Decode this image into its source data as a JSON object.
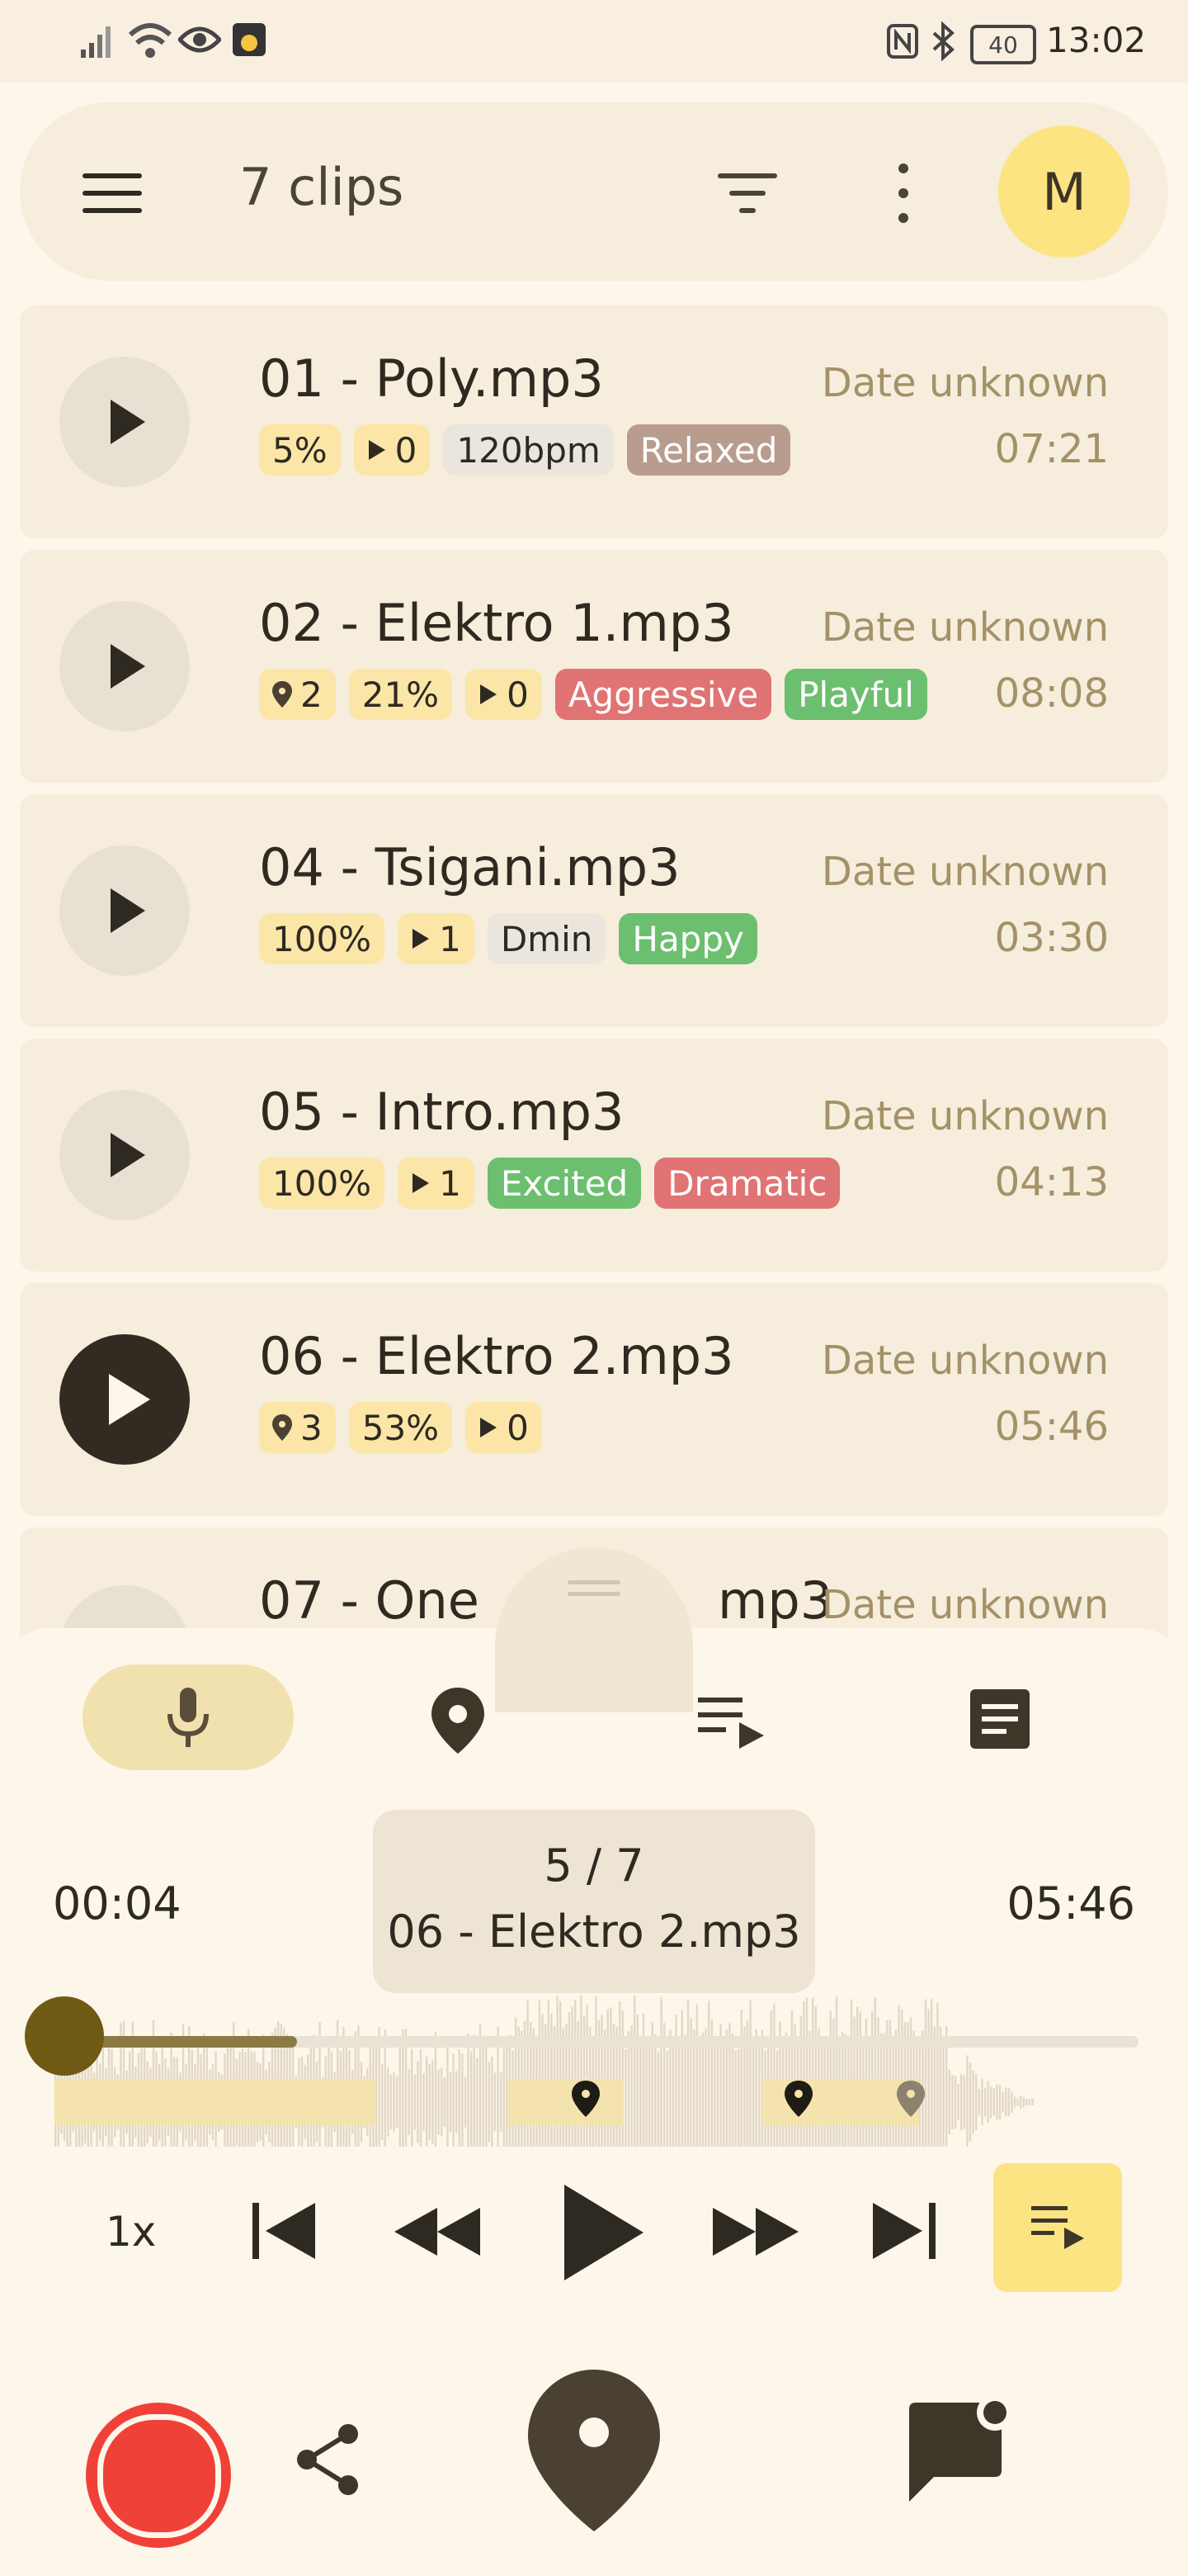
{
  "status_bar": {
    "battery": "40",
    "time": "13:02"
  },
  "app_bar": {
    "title": "7 clips",
    "avatar_letter": "M"
  },
  "clips": [
    {
      "title": "01 - Poly.mp3",
      "date": "Date unknown",
      "duration": "07:21",
      "chips": [
        {
          "text": "5%",
          "style": "y"
        },
        {
          "text": "0",
          "style": "y",
          "icon": "play"
        },
        {
          "text": "120bpm",
          "style": "g"
        },
        {
          "text": "Relaxed",
          "style": "brown"
        }
      ]
    },
    {
      "title": "02 - Elektro 1.mp3",
      "date": "Date unknown",
      "duration": "08:08",
      "chips": [
        {
          "text": "2",
          "style": "y",
          "icon": "pin"
        },
        {
          "text": "21%",
          "style": "y"
        },
        {
          "text": "0",
          "style": "y",
          "icon": "play"
        },
        {
          "text": "Aggressive",
          "style": "red"
        },
        {
          "text": "Playful",
          "style": "green"
        }
      ]
    },
    {
      "title": "04 - Tsigani.mp3",
      "date": "Date unknown",
      "duration": "03:30",
      "chips": [
        {
          "text": "100%",
          "style": "y"
        },
        {
          "text": "1",
          "style": "y",
          "icon": "play"
        },
        {
          "text": "Dmin",
          "style": "g"
        },
        {
          "text": "Happy",
          "style": "green"
        }
      ]
    },
    {
      "title": "05 - Intro.mp3",
      "date": "Date unknown",
      "duration": "04:13",
      "chips": [
        {
          "text": "100%",
          "style": "y"
        },
        {
          "text": "1",
          "style": "y",
          "icon": "play"
        },
        {
          "text": "Excited",
          "style": "green"
        },
        {
          "text": "Dramatic",
          "style": "red"
        }
      ]
    },
    {
      "title": "06 - Elektro 2.mp3",
      "date": "Date unknown",
      "duration": "05:46",
      "chips": [
        {
          "text": "3",
          "style": "y",
          "icon": "pin"
        },
        {
          "text": "53%",
          "style": "y"
        },
        {
          "text": "0",
          "style": "y",
          "icon": "play"
        }
      ]
    },
    {
      "title": "07 - One",
      "title_tail": "mp3",
      "date": "Date unknown"
    }
  ],
  "player": {
    "elapsed": "00:04",
    "total": "05:46",
    "position": "5 / 7",
    "track": "06 - Elektro 2.mp3",
    "speed": "1x",
    "progress_fraction": 0.012
  },
  "colors": {
    "accent_yellow": "#fde482",
    "record_red": "#f04138",
    "dark": "#4a4133"
  }
}
